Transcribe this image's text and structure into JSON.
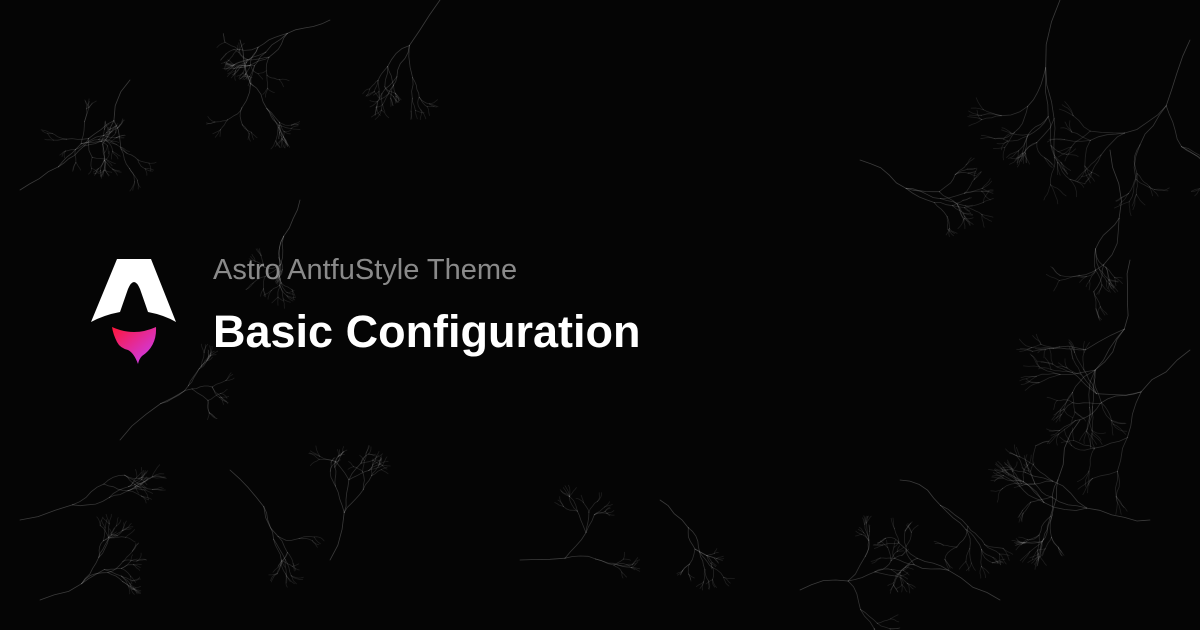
{
  "card": {
    "subtitle": "Astro AntfuStyle Theme",
    "title": "Basic Configuration",
    "logo_icon": "astro-logo-icon"
  },
  "colors": {
    "background": "#050505",
    "title": "#ffffff",
    "subtitle": "#8a8a8a",
    "logo_body": "#ffffff",
    "logo_flame_top": "#ff1639",
    "logo_flame_bottom": "#c640ff",
    "branches": "#ffffff"
  }
}
